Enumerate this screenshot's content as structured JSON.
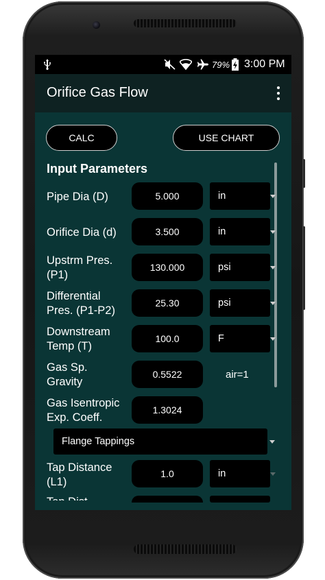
{
  "status": {
    "battery_pct": "79%",
    "time": "3:00 PM"
  },
  "app": {
    "title": "Orifice Gas Flow"
  },
  "buttons": {
    "calc": "CALC",
    "use_chart": "USE CHART"
  },
  "section_title": "Input Parameters",
  "rows": [
    {
      "label": "Pipe Dia (D)",
      "value": "5.000",
      "unit": "in"
    },
    {
      "label": "Orifice Dia (d)",
      "value": "3.500",
      "unit": "in"
    },
    {
      "label": "Upstrm Pres.",
      "label2": "(P1)",
      "value": "130.000",
      "unit": "psi"
    },
    {
      "label": "Differential",
      "label2": "Pres. (P1-P2)",
      "value": "25.30",
      "unit": "psi"
    },
    {
      "label": "Downstream",
      "label2": "Temp (T)",
      "value": "100.0",
      "unit": "F"
    },
    {
      "label": "Gas Sp.",
      "label2": "Gravity",
      "value": "0.5522",
      "unit_text": "air=1"
    },
    {
      "label": "Gas Isentropic",
      "label2": "Exp. Coeff.",
      "value": "1.3024"
    },
    {
      "label": "Tap Distance",
      "label2": "(L1)",
      "value": "1.0",
      "unit": "in"
    },
    {
      "label": "Tap Dist",
      "value": ""
    }
  ],
  "tapping_select": "Flange Tappings",
  "icons": {
    "usb": "usb-icon",
    "mute": "mute-icon",
    "wifi": "wifi-icon",
    "airplane": "airplane-icon",
    "battery": "battery-charging-icon",
    "overflow": "overflow-menu-icon",
    "dropdown": "dropdown-caret-icon"
  }
}
